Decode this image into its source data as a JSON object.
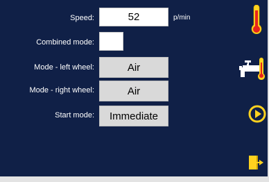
{
  "form": {
    "speed": {
      "label": "Speed:",
      "value": "52",
      "unit": "p/min"
    },
    "combined_mode": {
      "label": "Combined mode:",
      "checked": false
    },
    "left_wheel": {
      "label": "Mode - left wheel:",
      "value": "Air"
    },
    "right_wheel": {
      "label": "Mode - right wheel:",
      "value": "Air"
    },
    "start_mode": {
      "label": "Start mode:",
      "value": "Immediate"
    }
  },
  "toolbar": {
    "icons": [
      "thermometer-icon",
      "faucet-thermometer-icon",
      "play-icon",
      "exit-door-icon"
    ]
  },
  "colors": {
    "background": "#102047",
    "accent": "#ffd21f",
    "thermometer": "#e8231c",
    "button": "#d9d9d9"
  }
}
